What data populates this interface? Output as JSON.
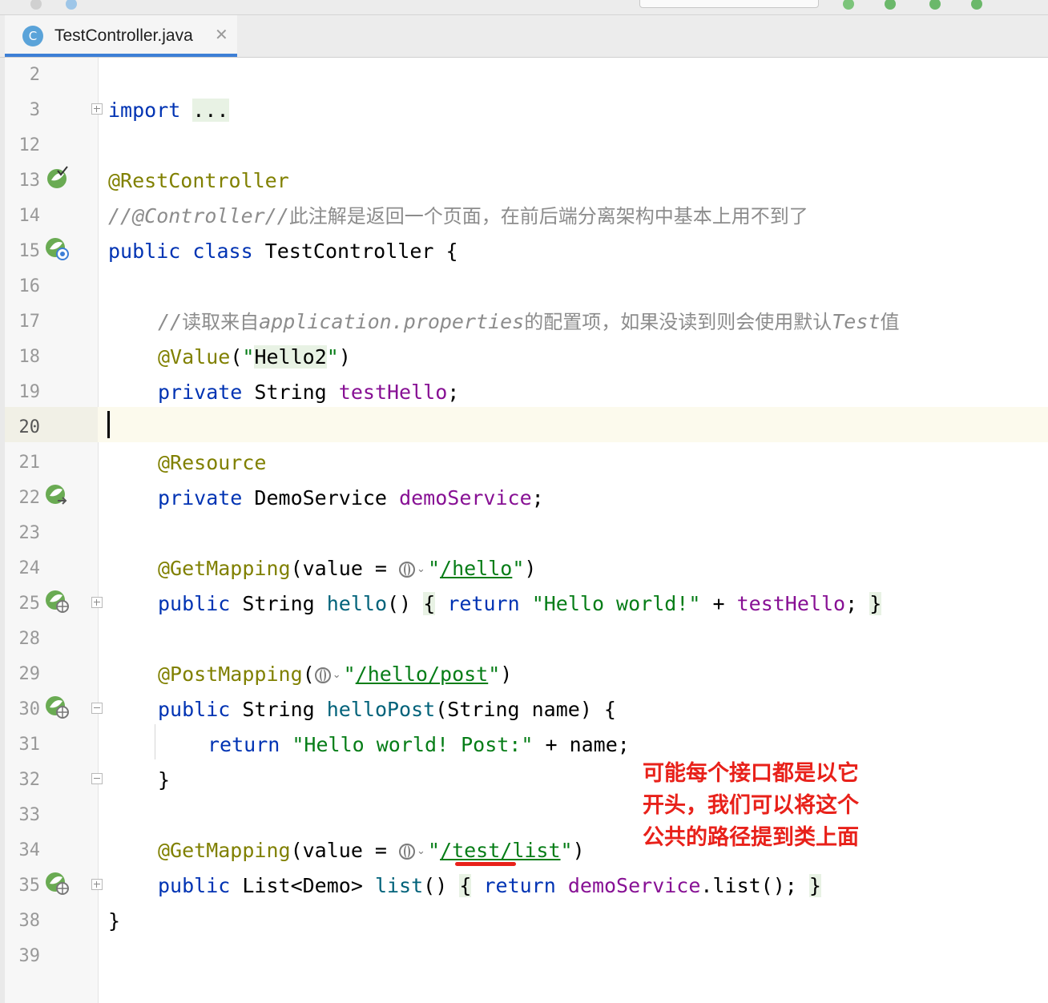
{
  "tab": {
    "icon_letter": "C",
    "title": "TestController.java",
    "close_symbol": "✕"
  },
  "colors": {
    "keyword": "#0033b3",
    "annotation": "#808000",
    "string": "#067d17",
    "comment": "#8c8c8c",
    "field": "#871094",
    "method": "#00627a",
    "note_red": "#e8211a"
  },
  "line_numbers": [
    "2",
    "3",
    "12",
    "13",
    "14",
    "15",
    "16",
    "17",
    "18",
    "19",
    "20",
    "21",
    "22",
    "23",
    "24",
    "25",
    "28",
    "29",
    "30",
    "31",
    "32",
    "33",
    "34",
    "35",
    "38",
    "39"
  ],
  "code": {
    "l3_import": "import",
    "l3_fold": "...",
    "l13_ann": "@RestController",
    "l14_cmt": "//@Controller//",
    "l14_cmt_cn": "此注解是返回一个页面，在前后端分离架构中基本上用不到了",
    "l15_public": "public",
    "l15_class": "class",
    "l15_name": "TestController {",
    "l17_cmt_a": "//",
    "l17_cn_a": "读取来自",
    "l17_cmt_b": "application.properties",
    "l17_cn_b": "的配置项，如果没读到则会使用默认",
    "l17_cmt_c": "Test",
    "l17_cn_c": "值",
    "l18_ann": "@Value",
    "l18_open": "(",
    "l18_q1": "\"",
    "l18_val": "Hello2",
    "l18_q2": "\"",
    "l18_close": ")",
    "l19_private": "private",
    "l19_type": "String",
    "l19_field": "testHello",
    "l19_semi": ";",
    "l21_ann": "@Resource",
    "l22_private": "private",
    "l22_type": "DemoService",
    "l22_field": "demoService",
    "l22_semi": ";",
    "l24_ann": "@GetMapping",
    "l24_open": "(value = ",
    "l24_q1": "\"",
    "l24_path": "/hello",
    "l24_q2": "\"",
    "l24_close": ")",
    "l25_public": "public",
    "l25_type": "String",
    "l25_method": "hello",
    "l25_parens": "()",
    "l25_brace_open": "{",
    "l25_return": "return",
    "l25_str": "\"Hello world!\"",
    "l25_plus": "+",
    "l25_field": "testHello",
    "l25_semi": ";",
    "l25_brace_close": "}",
    "l29_ann": "@PostMapping",
    "l29_open": "(",
    "l29_q1": "\"",
    "l29_path": "/hello/post",
    "l29_q2": "\"",
    "l29_close": ")",
    "l30_public": "public",
    "l30_type": "String",
    "l30_method": "helloPost",
    "l30_params": "(String name) {",
    "l31_return": "return",
    "l31_str": "\"Hello world! Post:\"",
    "l31_rest": "+ name;",
    "l32_brace": "}",
    "l34_ann": "@GetMapping",
    "l34_open": "(value = ",
    "l34_q1": "\"",
    "l34_path": "/test/list",
    "l34_q2": "\"",
    "l34_close": ")",
    "l35_public": "public",
    "l35_type": "List<Demo>",
    "l35_method": "list",
    "l35_parens": "()",
    "l35_brace_open": "{",
    "l35_return": "return",
    "l35_field": "demoService",
    "l35_call": ".list();",
    "l35_brace_close": "}",
    "l38_brace": "}"
  },
  "gutter_icons": {
    "l13": "spring-bean-check-icon",
    "l15": "spring-bean-web-icon",
    "l22": "spring-bean-injection-icon",
    "l25": "spring-request-mapping-icon",
    "l30": "spring-request-mapping-icon",
    "l35": "spring-request-mapping-icon"
  },
  "annotation_note": {
    "line1": "可能每个接口都是以它",
    "line2": "开头，我们可以将这个",
    "line3": "公共的路径提到类上面"
  }
}
